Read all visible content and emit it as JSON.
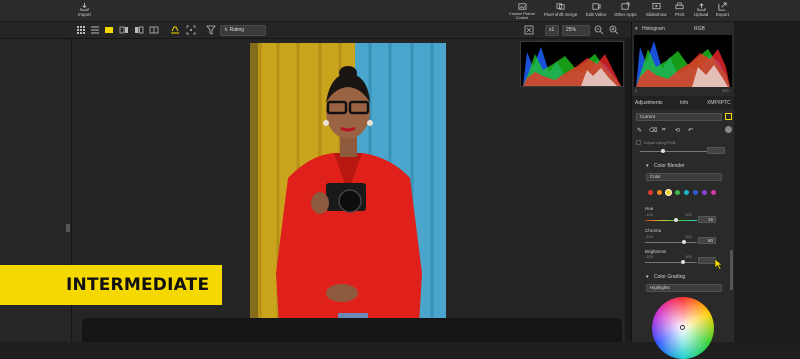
{
  "toolbar": {
    "import": "Import",
    "custom_picture_control": "Custom Picture Control",
    "pixel_shift_merge": "Pixel shift merge",
    "edit_video": "Edit Video",
    "other_apps": "Other Apps",
    "slideshow": "Slideshow",
    "print": "Print",
    "upload": "Upload",
    "export": "Export"
  },
  "subbar": {
    "sort_value": "Rating",
    "zoom_multiplier": "x1",
    "zoom_value": "25%"
  },
  "histogram_panel": {
    "title": "Histogram",
    "channel": "RGB",
    "axis_min": "0",
    "axis_max": "255"
  },
  "tabs": [
    "Adjustments",
    "Info",
    "XMP/IPTC"
  ],
  "adjustments": {
    "preset": "Current",
    "adjust_using_rgb": "Adjust using RGB",
    "color_blender_title": "Color Blender",
    "color_blender_mode": "Color",
    "swatches": [
      "#e23a2a",
      "#f08a1c",
      "#f2d21a",
      "#43b649",
      "#1bb7c7",
      "#2f5ad6",
      "#8e3fd0",
      "#d43aa6"
    ],
    "hue": {
      "label": "Hue",
      "min": "-100",
      "max": "100",
      "value": "15"
    },
    "chroma": {
      "label": "Chroma",
      "min": "-100",
      "max": "100",
      "value": "60"
    },
    "brightness": {
      "label": "Brightness",
      "min": "-100",
      "max": "100",
      "value": ""
    },
    "color_grading_title": "Color Grading",
    "color_grading_mode": "Highlights"
  },
  "banner": {
    "text": "INTERMEDIATE",
    "color": "#f5d800"
  }
}
